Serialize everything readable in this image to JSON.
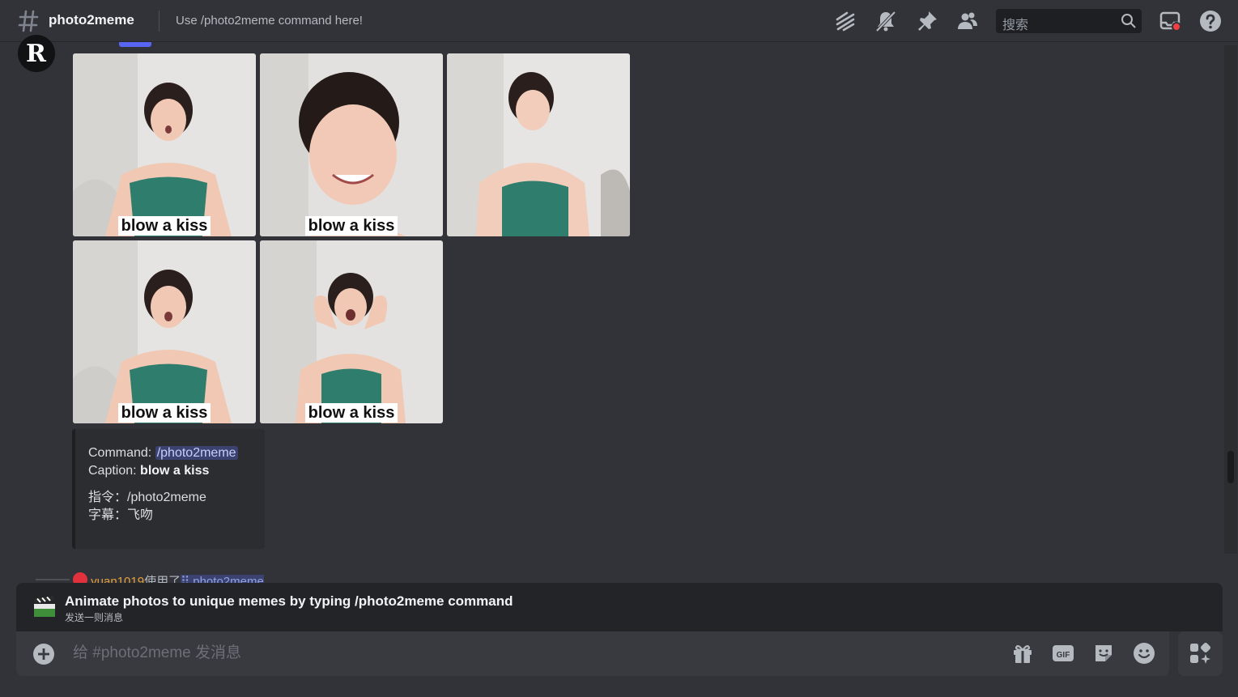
{
  "header": {
    "channel_name": "photo2meme",
    "topic": "Use /photo2meme command here!",
    "search_placeholder": "搜索",
    "icons": [
      "threads-icon",
      "mute-icon",
      "pin-icon",
      "members-icon",
      "inbox-icon",
      "help-icon"
    ]
  },
  "message": {
    "avatar_letter": "R",
    "tiles": [
      {
        "caption": "blow a kiss"
      },
      {
        "caption": "blow a kiss"
      },
      {
        "caption": ""
      },
      {
        "caption": "blow a kiss"
      },
      {
        "caption": "blow a kiss"
      }
    ],
    "embed": {
      "command_label": "Command:",
      "command_value": "/photo2meme",
      "caption_label": "Caption:",
      "caption_value": "blow a kiss",
      "zh_command_label": "指令：",
      "zh_command_value": "/photo2meme",
      "zh_caption_label": "字幕：",
      "zh_caption_value": "飞吻"
    }
  },
  "next_message": {
    "username": "yuan1019",
    "used_text": "使用了",
    "command": "photo2meme"
  },
  "app_banner": {
    "title": "Animate photos to unique memes by typing /photo2meme command",
    "subtitle": "发送一则消息"
  },
  "composer": {
    "placeholder": "给 #photo2meme 发消息",
    "icons": [
      "gift-icon",
      "gif-icon",
      "sticker-icon",
      "emoji-icon",
      "apps-icon"
    ]
  },
  "colors": {
    "background": "#313338",
    "header_text": "#f2f3f5",
    "mention_bg": "#3c4270",
    "username": "#e6a23c"
  }
}
